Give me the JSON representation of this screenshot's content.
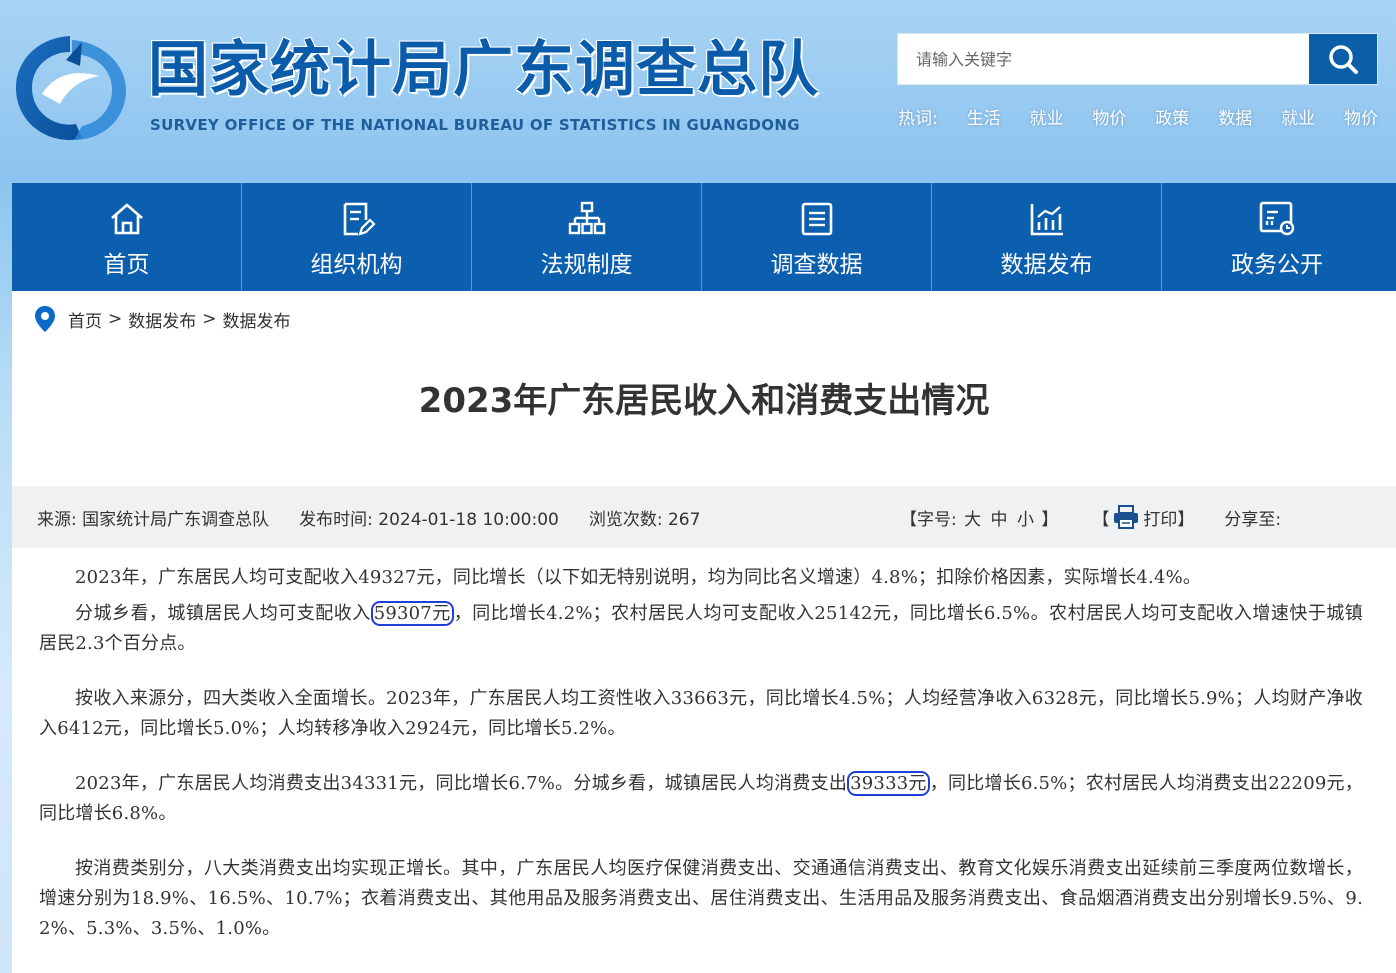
{
  "header": {
    "title": "国家统计局广东调查总队",
    "subtitle": "SURVEY OFFICE OF THE NATIONAL BUREAU OF STATISTICS IN GUANGDONG",
    "search": {
      "placeholder": "请输入关键字",
      "value": "",
      "icon": "search-icon"
    },
    "hot_label": "热词:",
    "hot_words": [
      "生活",
      "就业",
      "物价",
      "政策",
      "数据",
      "就业",
      "物价"
    ]
  },
  "nav": [
    {
      "label": "首页",
      "icon": "home-icon"
    },
    {
      "label": "组织机构",
      "icon": "document-edit-icon"
    },
    {
      "label": "法规制度",
      "icon": "org-chart-icon"
    },
    {
      "label": "调查数据",
      "icon": "list-doc-icon"
    },
    {
      "label": "数据发布",
      "icon": "bar-chart-icon"
    },
    {
      "label": "政务公开",
      "icon": "report-icon"
    }
  ],
  "breadcrumb": {
    "items": [
      "首页",
      "数据发布",
      "数据发布"
    ],
    "separator": ">"
  },
  "article": {
    "title": "2023年广东居民收入和消费支出情况",
    "meta": {
      "source": "来源: 国家统计局广东调查总队",
      "published": "发布时间: 2024-01-18 10:00:00",
      "views": "浏览次数: 267",
      "fontsize_open": "【字号:",
      "fontsize_large": "大",
      "fontsize_medium": "中",
      "fontsize_small": "小",
      "fontsize_close": "】",
      "print_open": "【",
      "print_label": "打印】",
      "share": "分享至:"
    },
    "p1": "2023年，广东居民人均可支配收入49327元，同比增长（以下如无特别说明，均为同比名义增速）4.8%；扣除价格因素，实际增长4.4%。",
    "p2_a": "分城乡看，城镇居民人均可支配收入",
    "p2_hl": "59307元",
    "p2_b": "，同比增长4.2%；农村居民人均可支配收入25142元，同比增长6.5%。农村居民人均可支配收入增速快于城镇居民2.3个百分点。",
    "p3": "按收入来源分，四大类收入全面增长。2023年，广东居民人均工资性收入33663元，同比增长4.5%；人均经营净收入6328元，同比增长5.9%；人均财产净收入6412元，同比增长5.0%；人均转移净收入2924元，同比增长5.2%。",
    "p4_a": "2023年，广东居民人均消费支出34331元，同比增长6.7%。分城乡看，城镇居民人均消费支出",
    "p4_hl": "39333元",
    "p4_b": "，同比增长6.5%；农村居民人均消费支出22209元，同比增长6.8%。",
    "p5": "按消费类别分，八大类消费支出均实现正增长。其中，广东居民人均医疗保健消费支出、交通通信消费支出、教育文化娱乐消费支出延续前三季度两位数增长，增速分别为18.9%、16.5%、10.7%；衣着消费支出、其他用品及服务消费支出、居住消费支出、生活用品及服务消费支出、食品烟酒消费支出分别增长9.5%、9.2%、5.3%、3.5%、1.0%。"
  },
  "colors": {
    "nav_bg": "#0b5fae",
    "title_blue": "#0a5cab",
    "highlight": "#1e3fd8"
  }
}
